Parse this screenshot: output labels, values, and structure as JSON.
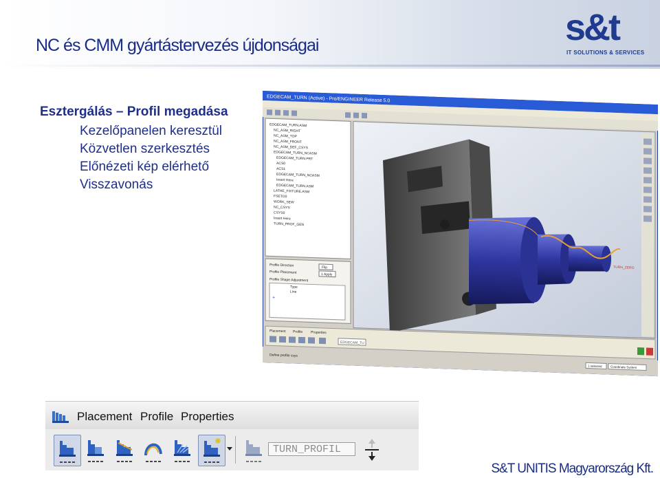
{
  "slide": {
    "title": "NC és CMM gyártástervezés újdonságai",
    "footer": "S&T UNITIS Magyarország Kft.",
    "logo": {
      "mark": "s&t",
      "subtitle": "IT SOLUTIONS & SERVICES"
    }
  },
  "content": {
    "heading": "Esztergálás – Profil megadása",
    "items": [
      "Kezelőpanelen keresztül",
      "Közvetlen szerkesztés",
      "Előnézeti kép elérhető",
      "Visszavonás"
    ]
  },
  "cad_window": {
    "title": "EDGECAM_TURN (Active) - Pro/ENGINEER Release 5.0",
    "tree_items": [
      "EDGECAM_TURN.ASM",
      "NC_ASM_RIGHT",
      "NC_ASM_TOP",
      "NC_ASM_FRONT",
      "NC_ASM_DEF_CSYS",
      "EDGECAM_TURN_NCASM",
      "EDGECAM_TURN.PRT",
      "ACS0",
      "ACS1",
      "EDGECAM_TURN_NCASM",
      "Insert Here",
      "EDGECAM_TURN.ASM",
      "LATHE_FIXTURE.ASM",
      "FSETO0",
      "WORK_SEW",
      "NC_CSYS",
      "CSYS0",
      "Insert Here",
      "TURN_PROF_GEN"
    ],
    "panel_labels": [
      "Profile Direction",
      "Profile Placement",
      "Profile Shape Adjustment",
      "Type",
      "Line"
    ],
    "panel_buttons": [
      "Flip",
      "1 Apply"
    ],
    "dashboard_tabs": [
      "Placement",
      "Profile",
      "Properties"
    ],
    "dashboard_field": "EDGECAM_TU",
    "status_text": "Define profile csys",
    "status_right": [
      "1 selected",
      "Coordinate System"
    ],
    "axis_label": "TURN_ZERO"
  },
  "toolbar": {
    "tabs": [
      "Placement",
      "Profile",
      "Properties"
    ],
    "field_value": "TURN_PROFIL",
    "icons": [
      "profile-sketch-icon",
      "profile-surface-icon",
      "profile-edge-icon",
      "profile-curve-icon",
      "profile-hatch-icon",
      "profile-select-icon",
      "dropdown-arrow-icon",
      "profile-inactive-icon",
      "direction-arrows-icon"
    ]
  },
  "colors": {
    "title_blue": "#1a2d86",
    "logo_blue": "#1f3a8f",
    "model_blue": "#2f3aa8",
    "chuck_gray": "#5a5a5a",
    "toolpath_orange": "#e8a030"
  }
}
